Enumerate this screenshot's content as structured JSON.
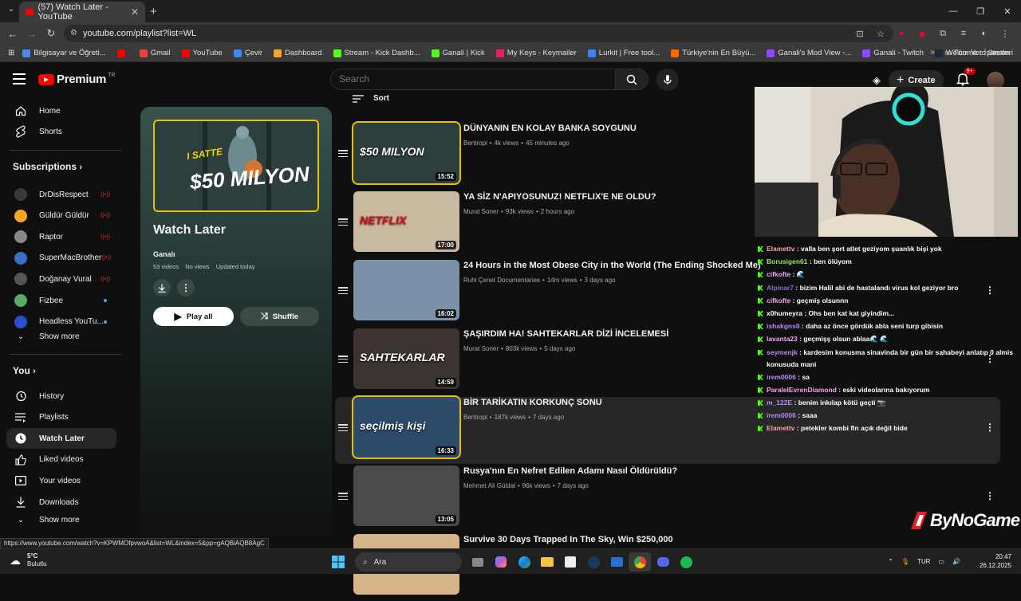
{
  "browser": {
    "tab_title": "(57) Watch Later - YouTube",
    "url": "youtube.com/playlist?list=WL",
    "bookmarks": [
      {
        "label": "Bilgisayar ve Öğreti...",
        "color": "#4a8af4"
      },
      {
        "label": "",
        "color": "#ff0000"
      },
      {
        "label": "Gmail",
        "color": "#ea4335"
      },
      {
        "label": "YouTube",
        "color": "#ff0000"
      },
      {
        "label": "Çevir",
        "color": "#4285f4"
      },
      {
        "label": "Dashboard",
        "color": "#f5a623"
      },
      {
        "label": "Stream - Kick Dashb...",
        "color": "#53fc18"
      },
      {
        "label": "Ganali | Kick",
        "color": "#53fc18"
      },
      {
        "label": "My Keys - Keymailer",
        "color": "#e91e63"
      },
      {
        "label": "Lurkit | Free tool...",
        "color": "#3b82f6"
      },
      {
        "label": "Türkiye'nin En Büyü...",
        "color": "#ff6600"
      },
      {
        "label": "Ganali's Mod View -...",
        "color": "#9146ff"
      },
      {
        "label": "Ganali - Twitch",
        "color": "#9146ff"
      },
      {
        "label": "Welcome to Steam",
        "color": "#1b2838"
      }
    ],
    "all_bookmarks": "Tüm Yer İşaretleri",
    "status_url": "https://www.youtube.com/watch?v=KPWMOfpvwoA&list=WL&index=5&pp=gAQBiAQB8AgC"
  },
  "masthead": {
    "logo": "Premium",
    "region": "TR",
    "search_placeholder": "Search",
    "create": "Create",
    "notif_count": "9+"
  },
  "guide": {
    "home": "Home",
    "shorts": "Shorts",
    "subscriptions_title": "Subscriptions",
    "subscriptions": [
      {
        "name": "DrDisRespect",
        "status": "live",
        "color": "#3a3a3a"
      },
      {
        "name": "Güldür Güldür",
        "status": "live",
        "color": "#f5a623"
      },
      {
        "name": "Raptor",
        "status": "live",
        "color": "#888888"
      },
      {
        "name": "SuperMacBrother",
        "status": "live",
        "color": "#3a6fc4"
      },
      {
        "name": "Doğanay Vural",
        "status": "live",
        "color": "#555555"
      },
      {
        "name": "Fizbee",
        "status": "new",
        "color": "#5aa86a"
      },
      {
        "name": "Headless YouTu...",
        "status": "new",
        "color": "#2a4fd0"
      }
    ],
    "show_more_1": "Show more",
    "you_title": "You",
    "you_items": [
      "History",
      "Playlists",
      "Watch Later",
      "Liked videos",
      "Your videos",
      "Downloads"
    ],
    "show_more_2": "Show more"
  },
  "playlist": {
    "title": "Watch Later",
    "owner": "Ganalı",
    "video_count": "53 videos",
    "views": "No views",
    "updated": "Updated today",
    "play_all": "Play all",
    "shuffle": "Shuffle",
    "sort": "Sort",
    "hero_thumb_text_1": "I SATTE",
    "hero_thumb_text_2": "$50 MILYON"
  },
  "videos": [
    {
      "title": "DÜNYANIN EN KOLAY BANKA SOYGUNU",
      "channel": "Bentropi",
      "views": "4k views",
      "age": "45 minutes ago",
      "duration": "15:52",
      "thumb_text": "$50 MILYON",
      "thumb_color": "#2c3f3d"
    },
    {
      "title": "YA SİZ N'APIYOSUNUZ! NETFLIX'E NE OLDU?",
      "channel": "Murat Soner",
      "views": "93k views",
      "age": "2 hours ago",
      "duration": "17:00",
      "thumb_text": "NETFLIX",
      "thumb_color": "#c9b9a0"
    },
    {
      "title": "24 Hours in the Most Obese City in the World (The Ending Shocked Me)",
      "channel": "Ruhi Çenet Documentaries",
      "views": "14m views",
      "age": "3 days ago",
      "duration": "16:02",
      "thumb_text": "",
      "thumb_color": "#7a92a8"
    },
    {
      "title": "ŞAŞIRDIM HA! SAHTEKARLAR DİZİ İNCELEMESİ",
      "channel": "Murat Soner",
      "views": "803k views",
      "age": "5 days ago",
      "duration": "14:59",
      "thumb_text": "SAHTEKARLAR",
      "thumb_color": "#3b3330"
    },
    {
      "title": "BİR TARİKATIN KORKUNÇ SONU",
      "channel": "Bentropi",
      "views": "187k views",
      "age": "7 days ago",
      "duration": "16:33",
      "thumb_text": "seçilmiş kişi",
      "thumb_color": "#2e4a6a"
    },
    {
      "title": "Rusya'nın En Nefret Edilen Adamı Nasıl Öldürüldü?",
      "channel": "Mehmet Ali Güldal",
      "views": "96k views",
      "age": "7 days ago",
      "duration": "13:05",
      "thumb_text": "",
      "thumb_color": "#4a4a4a"
    },
    {
      "title": "Survive 30 Days Trapped In The Sky, Win $250,000",
      "channel": "",
      "views": "",
      "age": "",
      "duration": "",
      "thumb_text": "",
      "thumb_color": "#d8b48a"
    }
  ],
  "chat": [
    {
      "user": "Elamettv",
      "color": "#f5a5a5",
      "msg": "valla ben şort atlet geziyom şuanlık bişi yok"
    },
    {
      "user": "Borusigen61",
      "color": "#9ee36a",
      "msg": "ben ölüyom"
    },
    {
      "user": "cifkofte",
      "color": "#f5a5f5",
      "msg": "🌊"
    },
    {
      "user": "Alpinar7",
      "color": "#8a6ad8",
      "msg": "bizim Halil abi de hastalandı virus kol geziyor bro"
    },
    {
      "user": "cifkofte",
      "color": "#f5a5f5",
      "msg": "geçmiş olsunnn"
    },
    {
      "user": "x0humeyra",
      "color": "#ffffff",
      "msg": "Ohs ben kat kat giyindim..."
    },
    {
      "user": "ishakgns0",
      "color": "#b88af5",
      "msg": "daha az önce gördük abla seni turp gibisin"
    },
    {
      "user": "lavanta23",
      "color": "#f5a5f5",
      "msg": "geçmişş olsun ablaa🌊 🌊"
    },
    {
      "user": "seymenjk",
      "color": "#b88af5",
      "msg": "kardesim konusma sinavinda bir gün bir sahabeyi anlatıp 0 almis konusuda mani"
    },
    {
      "user": "irem0006",
      "color": "#b88af5",
      "msg": "sa"
    },
    {
      "user": "ParalelEvrenDiamond",
      "color": "#f5a5f5",
      "msg": "eski videolarına bakıyorum"
    },
    {
      "user": "m_122E",
      "color": "#b88af5",
      "msg": "benim inkılap kötü geçti 📷"
    },
    {
      "user": "irem0006",
      "color": "#b88af5",
      "msg": "saaa"
    },
    {
      "user": "Elamettv",
      "color": "#f5a5a5",
      "msg": "petekler kombi fln açık değil bide"
    }
  ],
  "overlay": {
    "brand": "ByNoGame"
  },
  "taskbar": {
    "temp": "5°C",
    "weather": "Bulutlu",
    "search": "Ara",
    "lang": "TUR",
    "time": "20:47",
    "date": "26.12.2025"
  }
}
